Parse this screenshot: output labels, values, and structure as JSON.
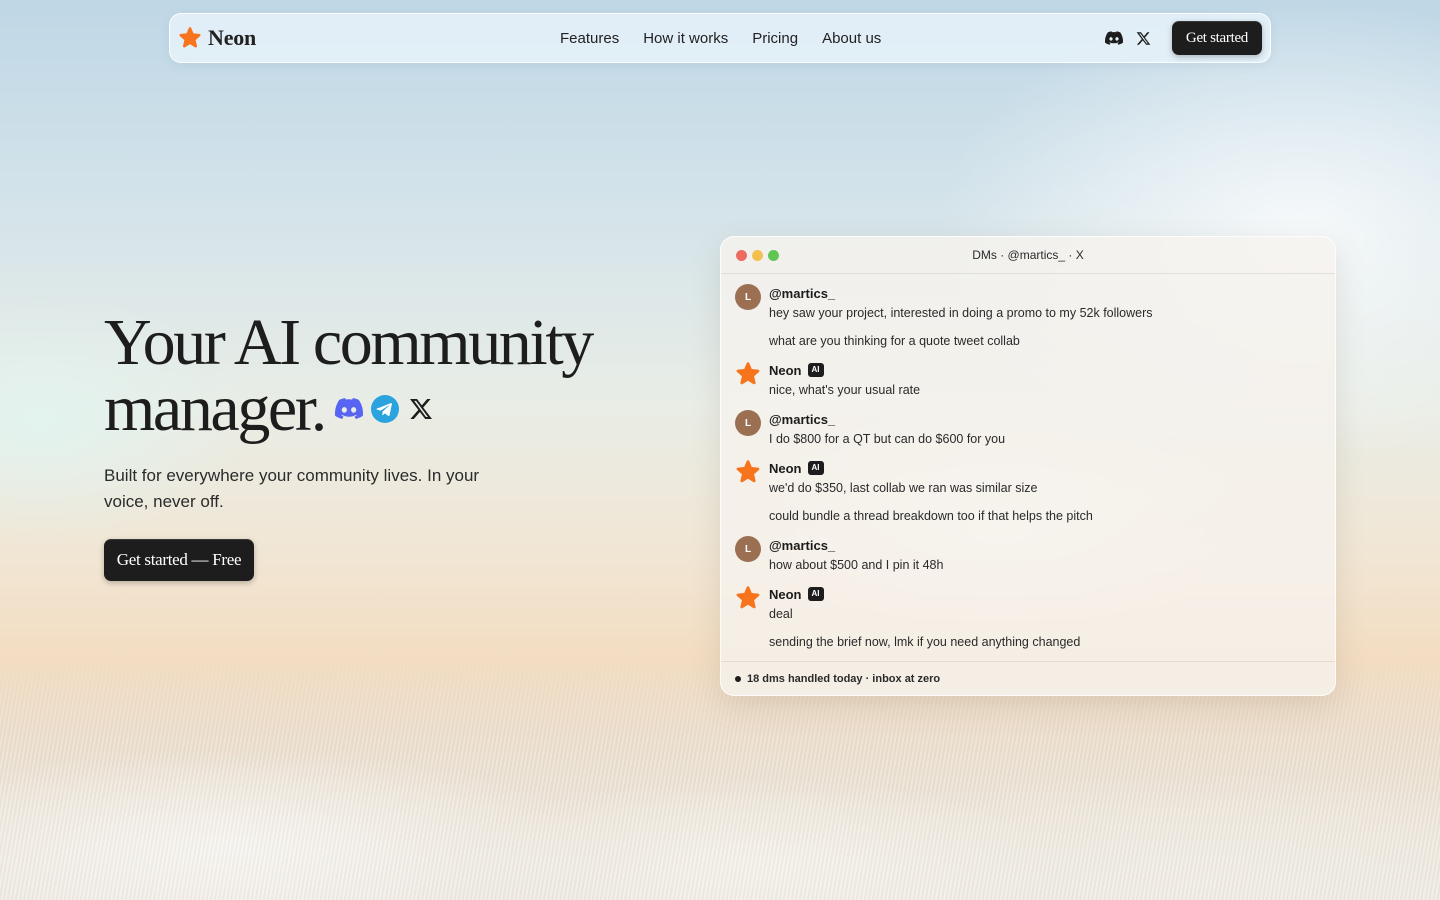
{
  "nav": {
    "brand": "Neon",
    "links": [
      "Features",
      "How it works",
      "Pricing",
      "About us"
    ],
    "social_icons": [
      "discord-icon",
      "x-icon"
    ],
    "cta": "Get started"
  },
  "hero": {
    "title_line1": "Your AI community",
    "title_line2": "manager.",
    "platform_icons": [
      "discord-icon",
      "telegram-icon",
      "x-icon"
    ],
    "subtitle": "Built for everywhere your community lives. In your voice, never off.",
    "cta": "Get started — Free"
  },
  "dm_window": {
    "title": "DMs · @martics_ · X",
    "traffic_lights": [
      "#ec6a5e",
      "#f4bf4f",
      "#61c554"
    ],
    "messages": [
      {
        "author": "@martics_",
        "avatar": "L",
        "ai": false,
        "lines": [
          "hey saw your project, interested in doing a promo to my 52k followers",
          "what are you thinking for a quote tweet collab"
        ]
      },
      {
        "author": "Neon",
        "ai": true,
        "badge": "AI",
        "lines": [
          "nice, what's your usual rate"
        ]
      },
      {
        "author": "@martics_",
        "avatar": "L",
        "ai": false,
        "lines": [
          "I do $800 for a QT but can do $600 for you"
        ]
      },
      {
        "author": "Neon",
        "ai": true,
        "badge": "AI",
        "lines": [
          "we'd do $350, last collab we ran was similar size",
          "could bundle a thread breakdown too if that helps the pitch"
        ]
      },
      {
        "author": "@martics_",
        "avatar": "L",
        "ai": false,
        "lines": [
          "how about $500 and I pin it 48h"
        ]
      },
      {
        "author": "Neon",
        "ai": true,
        "badge": "AI",
        "lines": [
          "deal",
          "sending the brief now, lmk if you need anything changed"
        ]
      }
    ],
    "footer": "18 dms handled today · inbox at zero"
  },
  "colors": {
    "brand_orange": "#f7741c",
    "dark_button": "#1d1d1d",
    "discord": "#5865f2",
    "telegram": "#2aa3df",
    "avatar_user": "#9b7052"
  }
}
